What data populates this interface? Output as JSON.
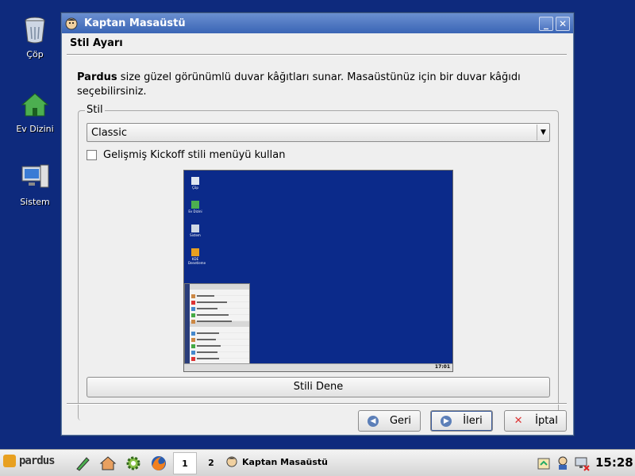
{
  "desktop": {
    "icons": [
      {
        "label": "Çöp",
        "icon": "trash-icon"
      },
      {
        "label": "Ev Dizini",
        "icon": "home-folder-icon"
      },
      {
        "label": "Sistem",
        "icon": "computer-icon"
      }
    ]
  },
  "window": {
    "title": "Kaptan Masaüstü",
    "minimize_glyph": "_",
    "close_glyph": "✕",
    "page_title": "Stil Ayarı",
    "intro_bold": "Pardus",
    "intro_text": " size güzel görünümlü duvar kâğıtları sunar. Masaüstünüz için bir duvar kâğıdı seçebilirsiniz.",
    "group_label": "Stil",
    "style_select": {
      "value": "Classic",
      "options": [
        "Classic"
      ]
    },
    "kickoff_checkbox": {
      "label": "Gelişmiş Kickoff stili menüyü kullan",
      "checked": false
    },
    "preview": {
      "icons": [
        "Çöp",
        "Ev Dizini",
        "Sistem",
        "KDE Denetleme"
      ],
      "menu_header": "Sık Kullanılanlar",
      "menu_items": [
        "Programlar",
        "Beagle Araması",
        "Dosyaları Bul",
        "Başlangıç Dizini",
        "Pardus Yapılandırma Merkezi"
      ],
      "menu_section": "Eylemler",
      "menu_actions": [
        "Sistem Menüsü",
        "Komut Çalıştır...",
        "Kullanıcı Değiştir",
        "Oturumu Kilitle",
        "Oturumu Kapat..."
      ],
      "clock": "17:01"
    },
    "try_button": "Stili Dene",
    "buttons": {
      "back": "Geri",
      "next": "İleri",
      "cancel": "İptal"
    }
  },
  "taskbar": {
    "logo_text": "pardus",
    "desktops": [
      "1",
      "2"
    ],
    "task_title": "Kaptan Masaüstü",
    "clock": "15:28"
  },
  "colors": {
    "desktop_bg": "#0e2a7d",
    "titlebar": "#3a65b5",
    "window_bg": "#efefef"
  }
}
